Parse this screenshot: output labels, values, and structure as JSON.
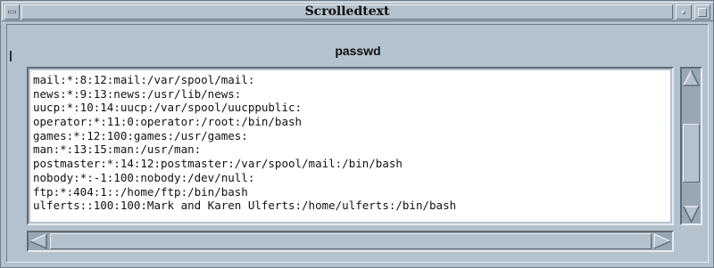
{
  "window": {
    "title": "Scrolledtext",
    "menu_icon": "window-menu-icon",
    "minimize_icon": "minimize-icon",
    "maximize_icon": "maximize-icon"
  },
  "heading": "passwd",
  "text_lines": [
    "mail:*:8:12:mail:/var/spool/mail:",
    "news:*:9:13:news:/usr/lib/news:",
    "uucp:*:10:14:uucp:/var/spool/uucppublic:",
    "operator:*:11:0:operator:/root:/bin/bash",
    "games:*:12:100:games:/usr/games:",
    "man:*:13:15:man:/usr/man:",
    "postmaster:*:14:12:postmaster:/var/spool/mail:/bin/bash",
    "nobody:*:-1:100:nobody:/dev/null:",
    "ftp:*:404:1::/home/ftp:/bin/bash",
    "ulferts::100:100:Mark and Karen Ulferts:/home/ulferts:/bin/bash"
  ],
  "scrollbars": {
    "vertical": {
      "up_icon": "arrow-up-icon",
      "down_icon": "arrow-down-icon",
      "position_fraction": 0.62
    },
    "horizontal": {
      "left_icon": "arrow-left-icon",
      "right_icon": "arrow-right-icon",
      "position_fraction": 0.0
    }
  },
  "colors": {
    "background": "#b4c2cd",
    "text_background": "#ffffff",
    "trough": "#98a7b3"
  }
}
